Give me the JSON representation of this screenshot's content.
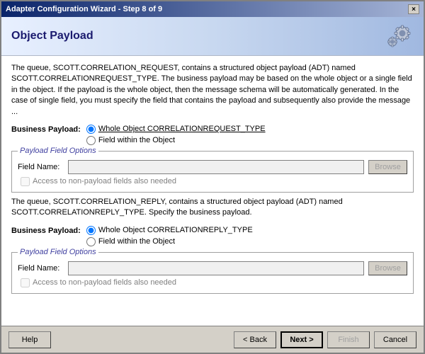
{
  "window": {
    "title": "Adapter Configuration Wizard - Step 8 of 9",
    "close_label": "×"
  },
  "header": {
    "title": "Object Payload"
  },
  "section1": {
    "description": "The queue, SCOTT.CORRELATION_REQUEST, contains a structured object payload (ADT) named SCOTT.CORRELATIONREQUEST_TYPE. The business payload may be based on the whole object or a single field in the object. If the payload is the whole object, then the message schema will be automatically generated. In the case of single field, you must specify the field that contains the payload and subsequently also provide the message ...",
    "business_payload_label": "Business Payload:",
    "radio1_label": "Whole Object CORRELATIONREQUEST_TYPE",
    "radio2_label": "Field within the Object",
    "payload_field_legend": "Payload Field Options",
    "field_name_label": "Field Name:",
    "browse_label": "Browse",
    "checkbox_label": "Access to non-payload fields also needed"
  },
  "section2": {
    "description": "The queue, SCOTT.CORRELATION_REPLY, contains a structured object payload (ADT) named SCOTT.CORRELATIONREPLY_TYPE. Specify the business payload.",
    "business_payload_label": "Business Payload:",
    "radio1_label": "Whole Object CORRELATIONREPLY_TYPE",
    "radio2_label": "Field within the Object",
    "payload_field_legend": "Payload Field Options",
    "field_name_label": "Field Name:",
    "browse_label": "Browse",
    "checkbox_label": "Access to non-payload fields also needed"
  },
  "footer": {
    "help_label": "Help",
    "back_label": "< Back",
    "next_label": "Next >",
    "finish_label": "Finish",
    "cancel_label": "Cancel"
  }
}
